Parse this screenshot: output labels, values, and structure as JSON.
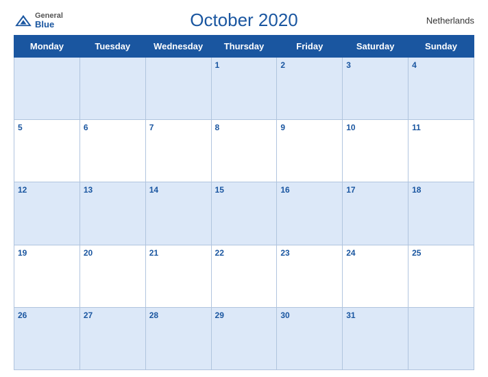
{
  "header": {
    "logo_general": "General",
    "logo_blue": "Blue",
    "month_title": "October 2020",
    "country": "Netherlands"
  },
  "weekdays": [
    "Monday",
    "Tuesday",
    "Wednesday",
    "Thursday",
    "Friday",
    "Saturday",
    "Sunday"
  ],
  "weeks": [
    [
      null,
      null,
      null,
      1,
      2,
      3,
      4
    ],
    [
      5,
      6,
      7,
      8,
      9,
      10,
      11
    ],
    [
      12,
      13,
      14,
      15,
      16,
      17,
      18
    ],
    [
      19,
      20,
      21,
      22,
      23,
      24,
      25
    ],
    [
      26,
      27,
      28,
      29,
      30,
      31,
      null
    ]
  ]
}
